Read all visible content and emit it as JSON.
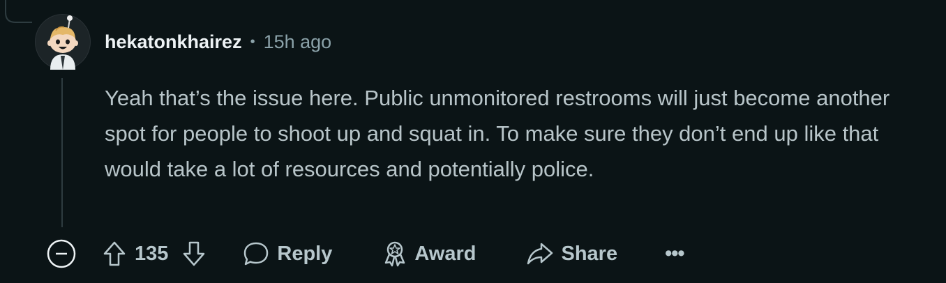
{
  "comment": {
    "username": "hekatonkhairez",
    "separator": "•",
    "timestamp": "15h ago",
    "body": "Yeah that’s the issue here. Public unmonitored restrooms will just become another spot for people to shoot up and squat in. To make sure they don’t end up like that would take a lot of resources and potentially police."
  },
  "actions": {
    "collapse_icon": "minus-circle-icon",
    "upvote_icon": "arrow-up-icon",
    "vote_count": "135",
    "downvote_icon": "arrow-down-icon",
    "reply_label": "Reply",
    "reply_icon": "speech-bubble-icon",
    "award_label": "Award",
    "award_icon": "award-icon",
    "share_label": "Share",
    "share_icon": "share-arrow-icon",
    "more_label": "•••"
  },
  "colors": {
    "background": "#0b1416",
    "username": "#eef3f5",
    "meta": "#8ba2a9",
    "body_text": "#b8c5c9",
    "thread_line": "#2e3c40"
  }
}
